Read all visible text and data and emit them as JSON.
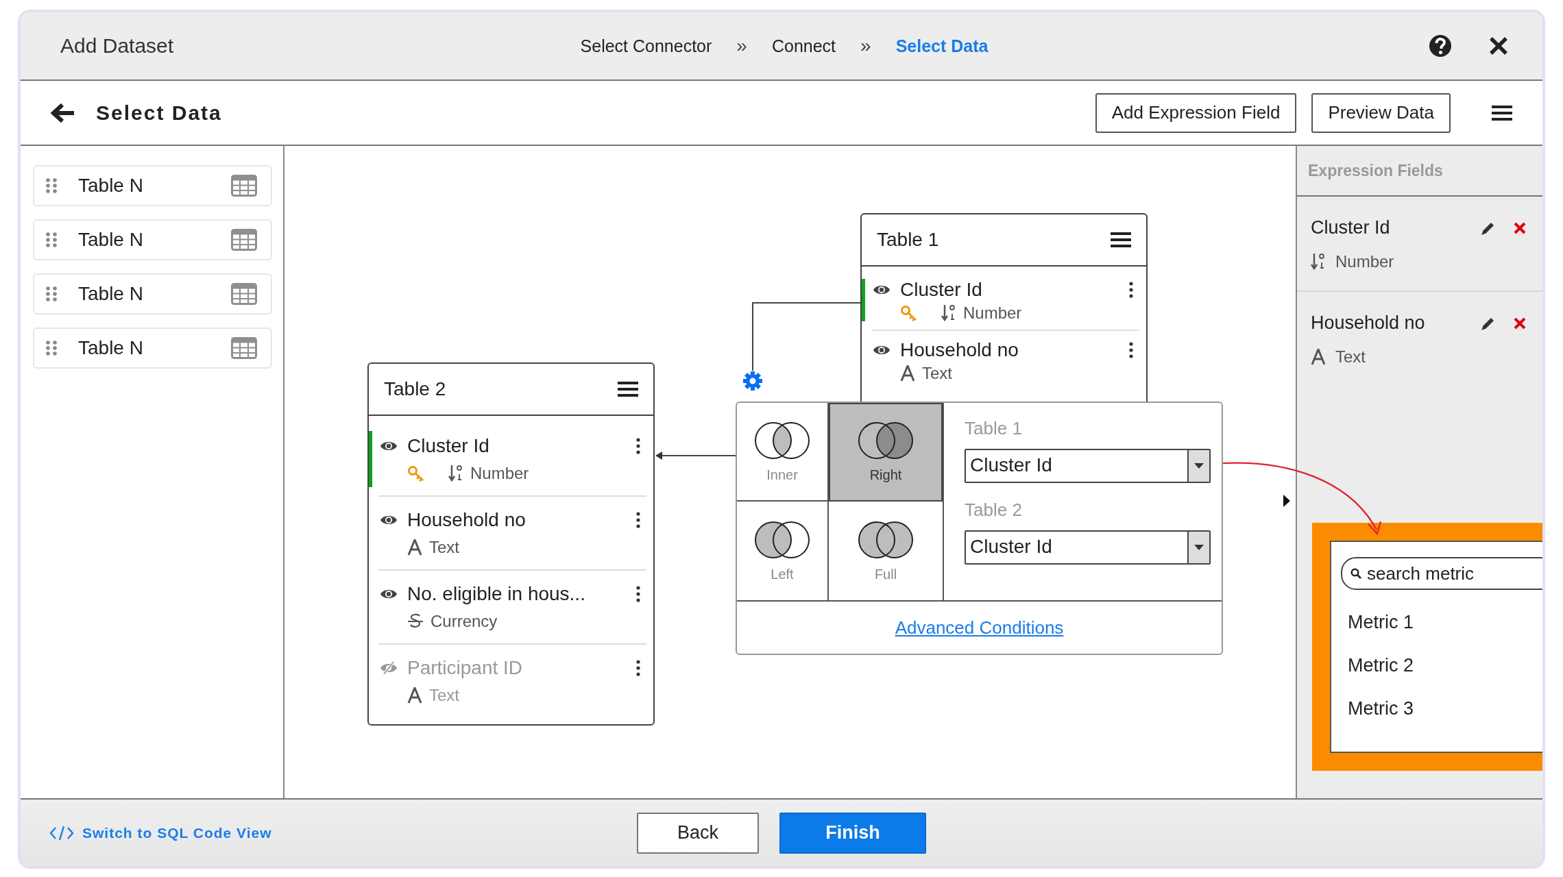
{
  "header": {
    "title": "Add Dataset",
    "steps": [
      {
        "label": "Select Connector",
        "selected": false
      },
      {
        "label": "Connect",
        "selected": false
      },
      {
        "label": "Select Data",
        "selected": true
      }
    ],
    "separators": [
      "»",
      "»"
    ]
  },
  "toolbar": {
    "title": "Select Data",
    "buttons": [
      "Add Expression Field",
      "Preview Data"
    ]
  },
  "sidebar": {
    "items": [
      {
        "label": "Table N"
      },
      {
        "label": "Table N"
      },
      {
        "label": "Table N"
      },
      {
        "label": "Table N"
      }
    ]
  },
  "tables": [
    {
      "title": "Table 1",
      "fields": [
        {
          "name": "Cluster Id",
          "type": "Number",
          "kind": "number",
          "key": true,
          "linked": true,
          "visible": true
        },
        {
          "name": "Household no",
          "type": "Text",
          "kind": "text",
          "key": false,
          "linked": false,
          "visible": true
        }
      ]
    },
    {
      "title": "Table 2",
      "fields": [
        {
          "name": "Cluster Id",
          "type": "Number",
          "kind": "number",
          "key": true,
          "linked": true,
          "visible": true
        },
        {
          "name": "Household no",
          "type": "Text",
          "kind": "text",
          "key": false,
          "linked": false,
          "visible": true
        },
        {
          "name": "No. eligible in hous...",
          "type": "Currency",
          "kind": "currency",
          "key": false,
          "linked": false,
          "visible": true
        },
        {
          "name": "Participant ID",
          "type": "Text",
          "kind": "text",
          "key": false,
          "linked": false,
          "visible": false
        }
      ]
    }
  ],
  "join": {
    "types": [
      {
        "label": "Inner",
        "kind": "inner",
        "selected": false
      },
      {
        "label": "Right",
        "kind": "right",
        "selected": true
      },
      {
        "label": "Left",
        "kind": "left",
        "selected": false
      },
      {
        "label": "Full",
        "kind": "full",
        "selected": false
      }
    ],
    "fields": [
      {
        "table": "Table 1",
        "value": "Cluster Id"
      },
      {
        "table": "Table 2",
        "value": "Cluster Id"
      }
    ],
    "link": "Advanced Conditions"
  },
  "expression_fields": {
    "title": "Expression Fields",
    "items": [
      {
        "name": "Cluster Id",
        "type": "Number",
        "kind": "number"
      },
      {
        "name": "Household no",
        "type": "Text",
        "kind": "text"
      }
    ]
  },
  "metric_picker": {
    "placeholder": "search metric",
    "items": [
      "Metric 1",
      "Metric 2",
      "Metric 3"
    ]
  },
  "footer": {
    "link": "Switch to SQL Code View",
    "buttons": [
      {
        "label": "Back",
        "primary": false
      },
      {
        "label": "Finish",
        "primary": true
      }
    ]
  }
}
